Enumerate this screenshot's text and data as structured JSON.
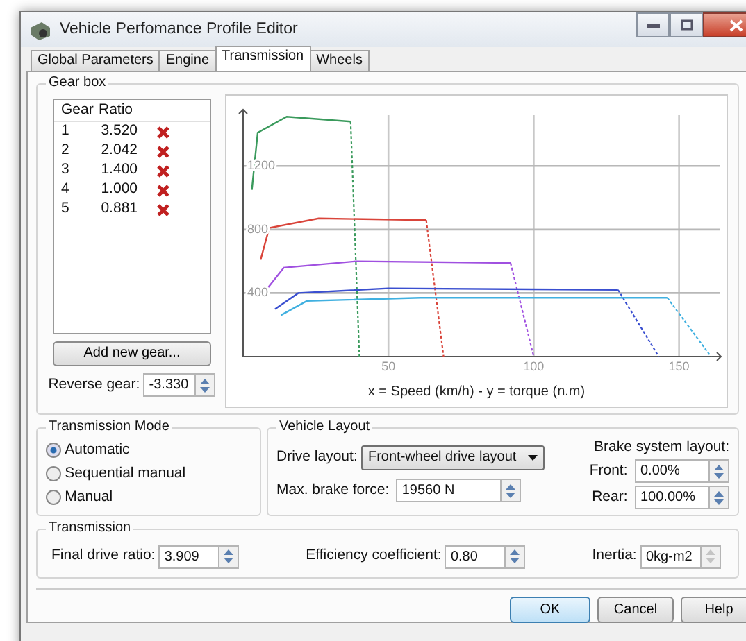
{
  "window": {
    "title": "Vehicle Perfomance Profile Editor"
  },
  "tabs": [
    {
      "label": "Global Parameters",
      "selected": false
    },
    {
      "label": "Engine",
      "selected": false
    },
    {
      "label": "Transmission",
      "selected": true
    },
    {
      "label": "Wheels",
      "selected": false
    }
  ],
  "gear_box": {
    "title": "Gear box",
    "columns": [
      "Gear",
      "Ratio"
    ],
    "rows": [
      {
        "gear": "1",
        "ratio": "3.520"
      },
      {
        "gear": "2",
        "ratio": "2.042"
      },
      {
        "gear": "3",
        "ratio": "1.400"
      },
      {
        "gear": "4",
        "ratio": "1.000"
      },
      {
        "gear": "5",
        "ratio": "0.881"
      }
    ],
    "add_button": "Add new gear...",
    "reverse_gear": {
      "label": "Reverse gear:",
      "value": "-3.330"
    },
    "chart_data": {
      "type": "line",
      "xlabel": "x = Speed (km/h) - y = torque (n.m)",
      "xlim": [
        0,
        163
      ],
      "ylim": [
        0,
        1520
      ],
      "xticks": [
        50,
        100,
        150
      ],
      "yticks": [
        400,
        800,
        1200
      ],
      "grid": true,
      "series": [
        {
          "color": "#3a9a5c",
          "x": [
            3,
            5,
            15,
            37,
            40
          ],
          "values": [
            1050,
            1410,
            1510,
            1480,
            0
          ]
        },
        {
          "color": "#d9443a",
          "x": [
            6,
            9,
            26,
            63,
            69
          ],
          "values": [
            610,
            810,
            870,
            860,
            0
          ]
        },
        {
          "color": "#a050e0",
          "x": [
            8,
            14,
            39,
            92,
            100
          ],
          "values": [
            420,
            560,
            600,
            590,
            0
          ]
        },
        {
          "color": "#3a4fd0",
          "x": [
            11,
            19,
            50,
            129,
            143
          ],
          "values": [
            300,
            400,
            430,
            420,
            0
          ]
        },
        {
          "color": "#40b0e0",
          "x": [
            13,
            22,
            61,
            146,
            161
          ],
          "values": [
            260,
            350,
            370,
            370,
            0
          ]
        }
      ]
    }
  },
  "transmission_mode": {
    "title": "Transmission Mode",
    "options": [
      {
        "label": "Automatic",
        "selected": true
      },
      {
        "label": "Sequential manual",
        "selected": false
      },
      {
        "label": "Manual",
        "selected": false
      }
    ]
  },
  "vehicle_layout": {
    "title": "Vehicle Layout",
    "drive_layout": {
      "label": "Drive layout:",
      "value": "Front-wheel drive layout"
    },
    "max_brake_force": {
      "label": "Max. brake force:",
      "value": "19560 N"
    },
    "brake_system": {
      "title": "Brake system layout:",
      "front": {
        "label": "Front:",
        "value": "0.00%"
      },
      "rear": {
        "label": "Rear:",
        "value": "100.00%"
      }
    }
  },
  "transmission": {
    "title": "Transmission",
    "fields": [
      {
        "label": "Final drive ratio:",
        "value": "3.909",
        "disabled": false
      },
      {
        "label": "Efficiency coefficient:",
        "value": "0.80",
        "disabled": false
      },
      {
        "label": "Inertia:",
        "value": "0kg-m2",
        "disabled": true
      }
    ]
  },
  "buttons": [
    {
      "label": "OK",
      "default": true
    },
    {
      "label": "Cancel",
      "default": false
    },
    {
      "label": "Help",
      "default": false
    }
  ]
}
